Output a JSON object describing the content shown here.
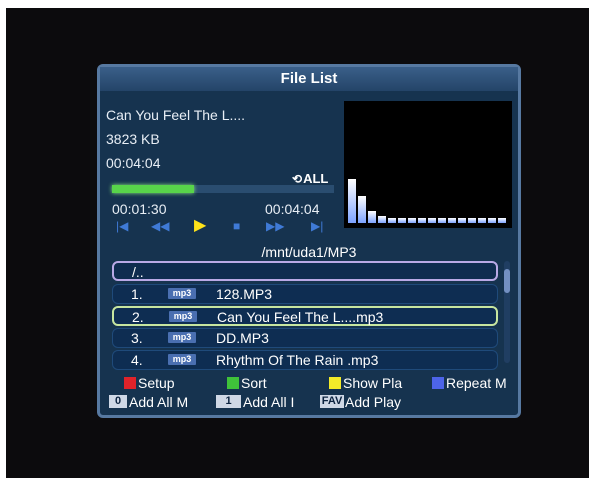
{
  "title": "File List",
  "now_playing": {
    "track": "Can You Feel The L....",
    "size": "3823 KB",
    "duration": "00:04:04",
    "repeat_mode": "ALL",
    "elapsed": "00:01:30",
    "total": "00:04:04",
    "progress": 0.37
  },
  "spectrum_levels": [
    0.36,
    0.22,
    0.1,
    0.06,
    0.04,
    0.04,
    0.04,
    0.04,
    0.04,
    0.04,
    0.04,
    0.04,
    0.04,
    0.04,
    0.04,
    0.04
  ],
  "path": "/mnt/uda1/MP3",
  "files": [
    {
      "num": "1.",
      "type": "mp3",
      "name": "128.MP3"
    },
    {
      "num": "2.",
      "type": "mp3",
      "name": "Can You Feel The L....mp3"
    },
    {
      "num": "3.",
      "type": "mp3",
      "name": "DD.MP3"
    },
    {
      "num": "4.",
      "type": "mp3",
      "name": "Rhythm Of The Rain .mp3"
    }
  ],
  "parent_dir": "/..",
  "legend": {
    "red": "Setup",
    "green": "Sort",
    "yellow": "Show Pla",
    "blue": "Repeat M"
  },
  "keys": {
    "k0_cap": "0",
    "k0_label": "Add All M",
    "k1_cap": "1",
    "k1_label": "Add All I",
    "fav_cap": "FAV",
    "fav_label": "Add Play"
  },
  "colors": {
    "red": "#e0232a",
    "green": "#3fc23a",
    "yellow": "#f2ea29",
    "blue": "#4d64e8",
    "progress": "#58d44a",
    "play": "#ffe31a"
  }
}
